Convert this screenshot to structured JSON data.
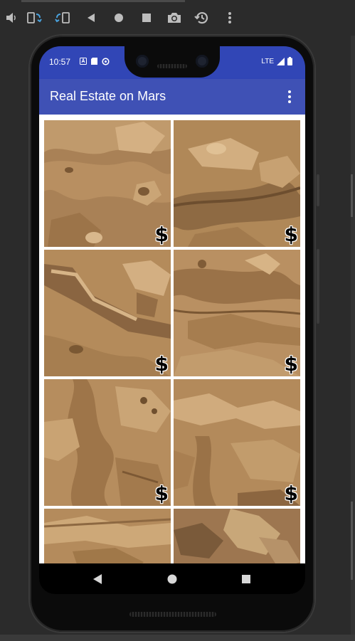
{
  "toolbar": {
    "buttons": [
      "volume-icon",
      "rotate-left-icon",
      "rotate-right-icon",
      "back-icon",
      "home-icon",
      "overview-icon",
      "camera-icon",
      "history-icon",
      "more-icon"
    ]
  },
  "status_bar": {
    "time": "10:57",
    "network": "LTE"
  },
  "app_bar": {
    "title": "Real Estate on Mars"
  },
  "grid": {
    "tiles": [
      {
        "price_symbol": "$"
      },
      {
        "price_symbol": "$"
      },
      {
        "price_symbol": "$"
      },
      {
        "price_symbol": "$"
      },
      {
        "price_symbol": "$"
      },
      {
        "price_symbol": "$"
      },
      {
        "price_symbol": ""
      },
      {
        "price_symbol": ""
      }
    ]
  },
  "colors": {
    "app_bar": "#3f51b5",
    "status_bar": "#3146b6",
    "mars_sand": "#b38a5c"
  }
}
